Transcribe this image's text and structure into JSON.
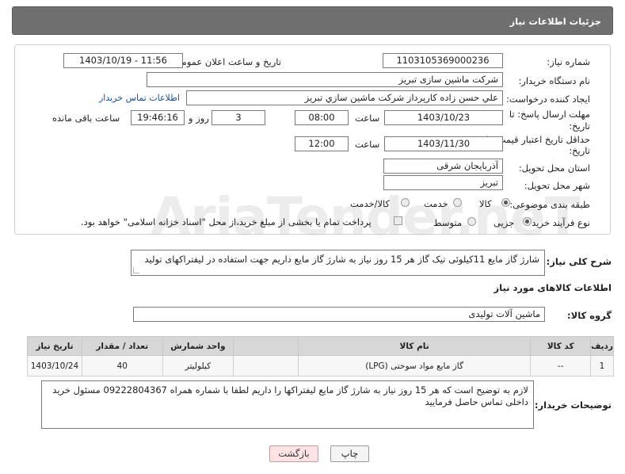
{
  "header": {
    "title": "جزئیات اطلاعات نیاز"
  },
  "fields": {
    "need_number": {
      "label": "شماره نیاز:",
      "value": "1103105369000236"
    },
    "announce_datetime": {
      "label": "تاریخ و ساعت اعلان عمومی:",
      "value": "1403/10/19 - 11:56"
    },
    "buyer_org": {
      "label": "نام دستگاه خریدار:",
      "value": "شرکت ماشین سازی تبریز"
    },
    "creator": {
      "label": "ایجاد کننده درخواست:",
      "value": "علي حسن زاده كارپرداز شركت ماشين سازي تبريز",
      "contact_link": "اطلاعات تماس خریدار"
    },
    "reply_deadline": {
      "label_line1": "مهلت ارسال پاسخ: تا",
      "label_line2": "تاریخ:",
      "date": "1403/10/23",
      "time_label": "ساعت",
      "time": "08:00",
      "days": "3",
      "days_label": "روز و",
      "remaining": "19:46:16",
      "remaining_label": "ساعت باقی مانده"
    },
    "price_validity": {
      "label_line1": "حداقل تاریخ اعتبار قیمت: تا",
      "label_line2": "تاریخ:",
      "date": "1403/11/30",
      "time_label": "ساعت",
      "time": "12:00"
    },
    "delivery_province": {
      "label": "استان محل تحویل:",
      "value": "آذربایجان شرقی"
    },
    "delivery_city": {
      "label": "شهر محل تحویل:",
      "value": "تبریز"
    },
    "category": {
      "label": "طبقه بندی موضوعی:",
      "options": [
        "کالا",
        "خدمت",
        "کالا/خدمت"
      ],
      "selected": "کالا"
    },
    "purchase_type": {
      "label": "نوع فرآیند خرید :",
      "options": [
        "جزیی",
        "متوسط"
      ],
      "selected": "جزیی",
      "treasury_note": "پرداخت تمام یا بخشی از مبلغ خرید،از محل \"اسناد خزانه اسلامی\" خواهد بود."
    }
  },
  "summary": {
    "label": "شرح کلی نیاز:",
    "value": "شارژ گاز مایع 11کیلوئی تیک گاز هر 15 روز نیاز به شارژ گاز مایع داریم جهت استفاده در لیفتراکهای تولید"
  },
  "goods_section": {
    "title": "اطلاعات کالاهای مورد نیاز",
    "group_label": "گروه کالا:",
    "group_value": "ماشین آلات تولیدی"
  },
  "goods_table": {
    "headers": [
      "ردیف",
      "کد کالا",
      "نام کالا",
      "واحد شمارش",
      "تعداد / مقدار",
      "تاریخ نیاز"
    ],
    "rows": [
      [
        "1",
        "--",
        "گاز مایع مواد سوختی (LPG)",
        "کیلولیتر",
        "40",
        "1403/10/24"
      ]
    ]
  },
  "buyer_notes": {
    "label": "توضیحات خریدار:",
    "value": "لازم به توضیح است که هر 15 روز نیاز به شارژ گاز مایع لیفتراکها را داریم لطفا با شماره همراه 09222804367 مسئول خرید داخلی تماس حاصل فرمایید"
  },
  "buttons": {
    "print": "چاپ",
    "back": "بازگشت"
  },
  "watermark": "AriaTender.neT"
}
